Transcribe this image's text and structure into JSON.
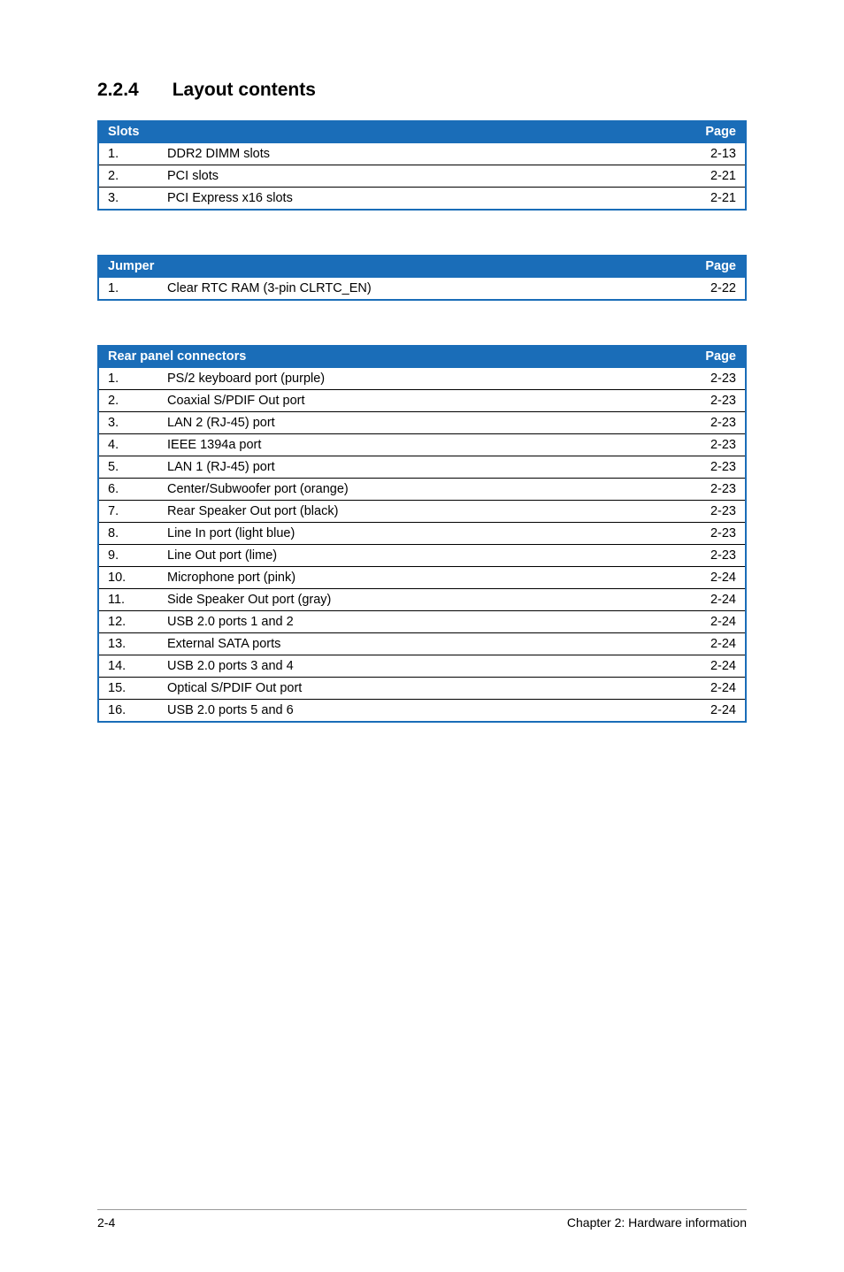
{
  "heading": {
    "number": "2.2.4",
    "title": "Layout contents"
  },
  "tables": {
    "slots": {
      "header_left": "Slots",
      "header_right": "Page",
      "rows": [
        {
          "num": "1.",
          "desc": "DDR2 DIMM slots",
          "page": "2-13"
        },
        {
          "num": "2.",
          "desc": "PCI slots",
          "page": "2-21"
        },
        {
          "num": "3.",
          "desc": "PCI Express x16 slots",
          "page": "2-21"
        }
      ]
    },
    "jumper": {
      "header_left": "Jumper",
      "header_right": "Page",
      "rows": [
        {
          "num": "1.",
          "desc": "Clear RTC RAM (3-pin CLRTC_EN)",
          "page": "2-22"
        }
      ]
    },
    "rear_panel": {
      "header_left": "Rear panel connectors",
      "header_right": "Page",
      "rows": [
        {
          "num": "1.",
          "desc": "PS/2 keyboard port (purple)",
          "page": "2-23"
        },
        {
          "num": "2.",
          "desc": "Coaxial S/PDIF Out port",
          "page": "2-23"
        },
        {
          "num": "3.",
          "desc": "LAN 2 (RJ-45) port",
          "page": "2-23"
        },
        {
          "num": "4.",
          "desc": "IEEE 1394a port",
          "page": "2-23"
        },
        {
          "num": "5.",
          "desc": "LAN 1 (RJ-45) port",
          "page": "2-23"
        },
        {
          "num": "6.",
          "desc": "Center/Subwoofer port (orange)",
          "page": "2-23"
        },
        {
          "num": "7.",
          "desc": "Rear Speaker Out port (black)",
          "page": "2-23"
        },
        {
          "num": "8.",
          "desc": "Line In port (light blue)",
          "page": "2-23"
        },
        {
          "num": "9.",
          "desc": "Line Out port (lime)",
          "page": "2-23"
        },
        {
          "num": "10.",
          "desc": "Microphone port (pink)",
          "page": "2-24"
        },
        {
          "num": "11.",
          "desc": "Side Speaker Out port (gray)",
          "page": "2-24"
        },
        {
          "num": "12.",
          "desc": "USB 2.0 ports 1 and 2",
          "page": "2-24"
        },
        {
          "num": "13.",
          "desc": "External SATA ports",
          "page": "2-24"
        },
        {
          "num": "14.",
          "desc": "USB 2.0 ports 3 and 4",
          "page": "2-24"
        },
        {
          "num": "15.",
          "desc": "Optical S/PDIF Out port",
          "page": "2-24"
        },
        {
          "num": "16.",
          "desc": "USB 2.0 ports 5 and 6",
          "page": "2-24"
        }
      ]
    }
  },
  "footer": {
    "left": "2-4",
    "right": "Chapter 2: Hardware information"
  }
}
